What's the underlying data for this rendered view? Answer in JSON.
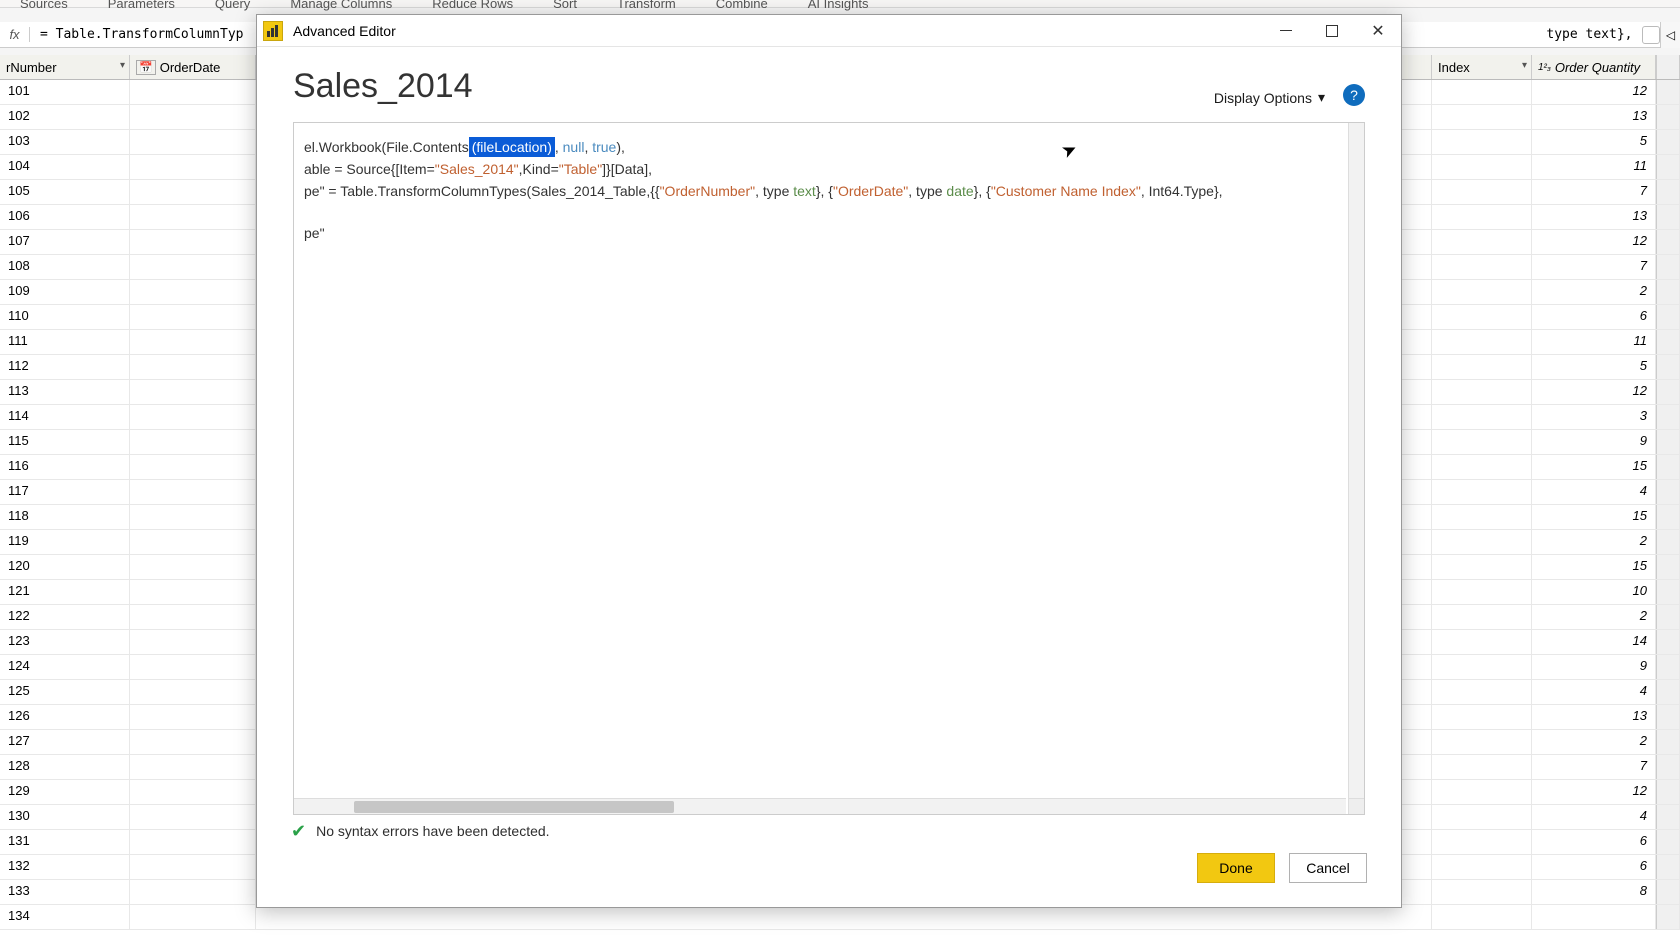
{
  "ribbon_groups": [
    "Sources",
    "Parameters",
    "Query",
    "Manage Columns",
    "Reduce Rows",
    "Sort",
    "Transform",
    "Combine",
    "AI Insights"
  ],
  "formula_bar": {
    "fx_label": "fx",
    "left_text": "= Table.TransformColumnTyp",
    "right_text": "type text},"
  },
  "grid": {
    "columns": {
      "row_number": "rNumber",
      "order_date": "OrderDate",
      "index": "Index",
      "order_qty": "Order Quantity",
      "index_type_prefix": "1²₃"
    },
    "rows": [
      {
        "n": "101",
        "qty": "12"
      },
      {
        "n": "102",
        "qty": "13"
      },
      {
        "n": "103",
        "qty": "5"
      },
      {
        "n": "104",
        "qty": "11"
      },
      {
        "n": "105",
        "qty": "7"
      },
      {
        "n": "106",
        "qty": "13"
      },
      {
        "n": "107",
        "qty": "12"
      },
      {
        "n": "108",
        "qty": "7"
      },
      {
        "n": "109",
        "qty": "2"
      },
      {
        "n": "110",
        "qty": "6"
      },
      {
        "n": "111",
        "qty": "11"
      },
      {
        "n": "112",
        "qty": "5"
      },
      {
        "n": "113",
        "qty": "12"
      },
      {
        "n": "114",
        "qty": "3"
      },
      {
        "n": "115",
        "qty": "9"
      },
      {
        "n": "116",
        "qty": "15"
      },
      {
        "n": "117",
        "qty": "4"
      },
      {
        "n": "118",
        "qty": "15"
      },
      {
        "n": "119",
        "qty": "2"
      },
      {
        "n": "120",
        "qty": "15"
      },
      {
        "n": "121",
        "qty": "10"
      },
      {
        "n": "122",
        "qty": "2"
      },
      {
        "n": "123",
        "qty": "14"
      },
      {
        "n": "124",
        "qty": "9"
      },
      {
        "n": "125",
        "qty": "4"
      },
      {
        "n": "126",
        "qty": "13"
      },
      {
        "n": "127",
        "qty": "2"
      },
      {
        "n": "128",
        "qty": "7"
      },
      {
        "n": "129",
        "qty": "12"
      },
      {
        "n": "130",
        "qty": "4"
      },
      {
        "n": "131",
        "qty": "6"
      },
      {
        "n": "132",
        "qty": "6"
      },
      {
        "n": "133",
        "qty": "8"
      },
      {
        "n": "134",
        "qty": ""
      }
    ]
  },
  "dialog": {
    "window_title": "Advanced Editor",
    "heading": "Sales_2014",
    "display_options_label": "Display Options",
    "code": {
      "line1": {
        "prefix": "el.Workbook(File.Contents",
        "selected": "(fileLocation)",
        "mid1": ", ",
        "null": "null",
        "mid2": ", ",
        "true": "true",
        "suffix": "),"
      },
      "line2": {
        "prefix": "able = Source{[Item=",
        "str1": "\"Sales_2014\"",
        "mid1": ",Kind=",
        "str2": "\"Table\"",
        "suffix": "]}[Data],"
      },
      "line3": {
        "prefix": "pe\" = Table.TransformColumnTypes(Sales_2014_Table,{{",
        "s1": "\"OrderNumber\"",
        "m1": ", type ",
        "t1": "text",
        "m2": "}, {",
        "s2": "\"OrderDate\"",
        "m3": ", type ",
        "t2": "date",
        "m4": "}, {",
        "s3": "\"Customer Name Index\"",
        "m5": ", Int64.Type},"
      },
      "line5": "pe\""
    },
    "status_text": "No syntax errors have been detected.",
    "done_label": "Done",
    "cancel_label": "Cancel"
  }
}
